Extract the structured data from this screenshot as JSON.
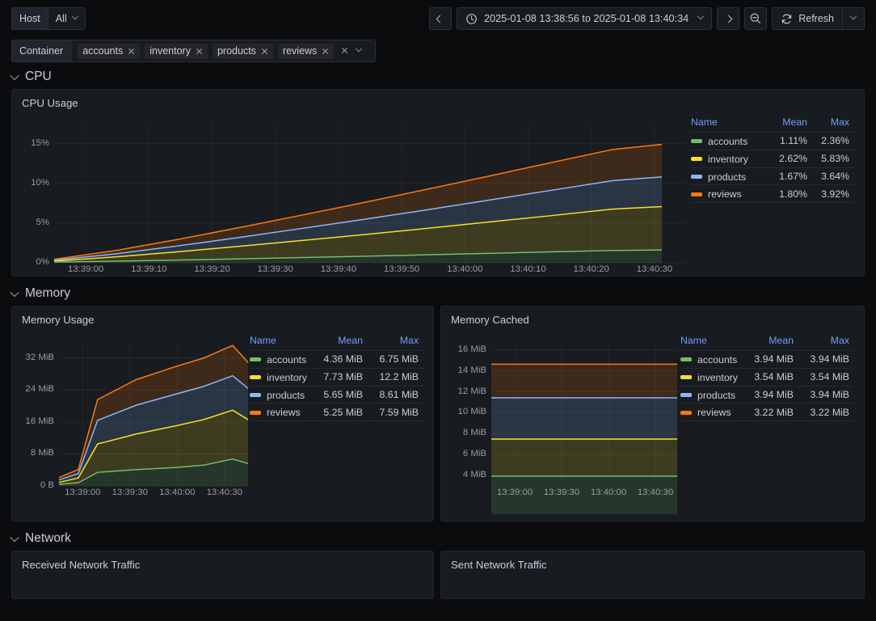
{
  "variables": [
    {
      "label": "Host",
      "value": "All",
      "name": "host"
    }
  ],
  "container_filter": {
    "label": "Container",
    "chips": [
      "accounts",
      "inventory",
      "products",
      "reviews"
    ]
  },
  "timepicker": {
    "range": "2025-01-08 13:38:56 to 2025-01-08 13:40:34",
    "prev_icon": "chevron-left-icon",
    "next_icon": "chevron-right-icon",
    "clock_icon": "clock-icon",
    "zoom_out_icon": "zoom-out-icon",
    "refresh_label": "Refresh",
    "refresh_icon": "refresh-icon"
  },
  "sections": [
    {
      "title": "CPU"
    },
    {
      "title": "Memory"
    },
    {
      "title": "Network"
    }
  ],
  "legend_headers": {
    "name": "Name",
    "mean": "Mean",
    "max": "Max"
  },
  "series_colors": {
    "accounts": "#73bf69",
    "inventory": "#fade2a",
    "products": "#8ab8ff",
    "reviews": "#ff780a"
  },
  "panels": {
    "cpu_usage": {
      "title": "CPU Usage",
      "legend": [
        {
          "name": "accounts",
          "mean": "1.11%",
          "max": "2.36%"
        },
        {
          "name": "inventory",
          "mean": "2.62%",
          "max": "5.83%"
        },
        {
          "name": "products",
          "mean": "1.67%",
          "max": "3.64%"
        },
        {
          "name": "reviews",
          "mean": "1.80%",
          "max": "3.92%"
        }
      ]
    },
    "memory_usage": {
      "title": "Memory Usage",
      "legend": [
        {
          "name": "accounts",
          "mean": "4.36 MiB",
          "max": "6.75 MiB"
        },
        {
          "name": "inventory",
          "mean": "7.73 MiB",
          "max": "12.2 MiB"
        },
        {
          "name": "products",
          "mean": "5.65 MiB",
          "max": "8.61 MiB"
        },
        {
          "name": "reviews",
          "mean": "5.25 MiB",
          "max": "7.59 MiB"
        }
      ]
    },
    "memory_cached": {
      "title": "Memory Cached",
      "legend": [
        {
          "name": "accounts",
          "mean": "3.94 MiB",
          "max": "3.94 MiB"
        },
        {
          "name": "inventory",
          "mean": "3.54 MiB",
          "max": "3.54 MiB"
        },
        {
          "name": "products",
          "mean": "3.94 MiB",
          "max": "3.94 MiB"
        },
        {
          "name": "reviews",
          "mean": "3.22 MiB",
          "max": "3.22 MiB"
        }
      ]
    },
    "received_network_traffic": {
      "title": "Received Network Traffic"
    },
    "sent_network_traffic": {
      "title": "Sent Network Traffic"
    }
  },
  "chart_data": [
    {
      "id": "cpu_usage",
      "type": "area",
      "stacked": true,
      "title": "CPU Usage",
      "xlabel": "",
      "ylabel": "",
      "unit": "%",
      "ytick_labels": [
        "0%",
        "5%",
        "10%",
        "15%"
      ],
      "ytick_values": [
        0,
        5,
        10,
        15
      ],
      "ylim": [
        0,
        17.5
      ],
      "xtick_labels": [
        "13:39:00",
        "13:39:10",
        "13:39:20",
        "13:39:30",
        "13:39:40",
        "13:39:50",
        "13:40:00",
        "13:40:10",
        "13:40:20",
        "13:40:30"
      ],
      "grid": true,
      "legend_position": "right",
      "x": [
        0,
        10,
        20,
        30,
        40,
        50,
        60,
        70,
        80,
        90,
        98
      ],
      "series": [
        {
          "name": "accounts",
          "color": "#73bf69",
          "values": [
            0.1,
            0.2,
            0.34,
            0.5,
            0.66,
            0.83,
            1.0,
            1.18,
            1.37,
            1.55,
            1.62
          ]
        },
        {
          "name": "inventory",
          "color": "#fade2a",
          "values": [
            0.12,
            0.55,
            1.05,
            1.58,
            2.15,
            2.72,
            3.32,
            3.94,
            4.55,
            5.2,
            5.45
          ]
        },
        {
          "name": "products",
          "color": "#8ab8ff",
          "values": [
            0.11,
            0.38,
            0.74,
            1.12,
            1.52,
            1.92,
            2.33,
            2.75,
            3.18,
            3.58,
            3.74
          ]
        },
        {
          "name": "reviews",
          "color": "#ff780a",
          "values": [
            0.12,
            0.42,
            0.82,
            1.25,
            1.68,
            2.12,
            2.58,
            3.02,
            3.48,
            3.92,
            4.1
          ]
        }
      ]
    },
    {
      "id": "memory_usage",
      "type": "area",
      "stacked": true,
      "title": "Memory Usage",
      "unit": "MiB",
      "ytick_labels": [
        "0 B",
        "8 MiB",
        "16 MiB",
        "24 MiB",
        "32 MiB"
      ],
      "ytick_values": [
        0,
        8,
        16,
        24,
        32
      ],
      "ylim": [
        0,
        36
      ],
      "xtick_labels": [
        "13:39:00",
        "13:39:30",
        "13:40:00",
        "13:40:30"
      ],
      "grid": true,
      "legend_position": "right",
      "x": [
        0,
        10,
        20,
        40,
        60,
        75,
        90,
        98
      ],
      "series": [
        {
          "name": "accounts",
          "color": "#73bf69",
          "values": [
            0.4,
            0.8,
            3.4,
            4.1,
            4.6,
            5.2,
            6.75,
            5.6
          ]
        },
        {
          "name": "inventory",
          "color": "#fade2a",
          "values": [
            0.5,
            1.2,
            7.1,
            8.9,
            10.4,
            11.4,
            12.2,
            11.0
          ]
        },
        {
          "name": "products",
          "color": "#8ab8ff",
          "values": [
            0.6,
            1.1,
            5.9,
            7.2,
            7.9,
            8.3,
            8.61,
            7.8
          ]
        },
        {
          "name": "reviews",
          "color": "#ff780a",
          "values": [
            0.6,
            1.0,
            5.2,
            6.4,
            6.9,
            7.1,
            7.59,
            6.5
          ]
        }
      ]
    },
    {
      "id": "memory_cached",
      "type": "area",
      "stacked": true,
      "title": "Memory Cached",
      "unit": "MiB",
      "ytick_labels": [
        "4 MiB",
        "6 MiB",
        "8 MiB",
        "10 MiB",
        "12 MiB",
        "14 MiB",
        "16 MiB"
      ],
      "ytick_values": [
        4,
        6,
        8,
        10,
        12,
        14,
        16
      ],
      "ylim": [
        3.0,
        16.6
      ],
      "xtick_labels": [
        "13:39:00",
        "13:39:30",
        "13:40:00",
        "13:40:30"
      ],
      "grid": true,
      "legend_position": "right",
      "x": [
        0,
        98
      ],
      "series": [
        {
          "name": "accounts",
          "color": "#73bf69",
          "values": [
            3.94,
            3.94
          ]
        },
        {
          "name": "inventory",
          "color": "#fade2a",
          "values": [
            3.54,
            3.54
          ]
        },
        {
          "name": "products",
          "color": "#8ab8ff",
          "values": [
            3.94,
            3.94
          ]
        },
        {
          "name": "reviews",
          "color": "#ff780a",
          "values": [
            3.22,
            3.22
          ]
        }
      ]
    }
  ]
}
